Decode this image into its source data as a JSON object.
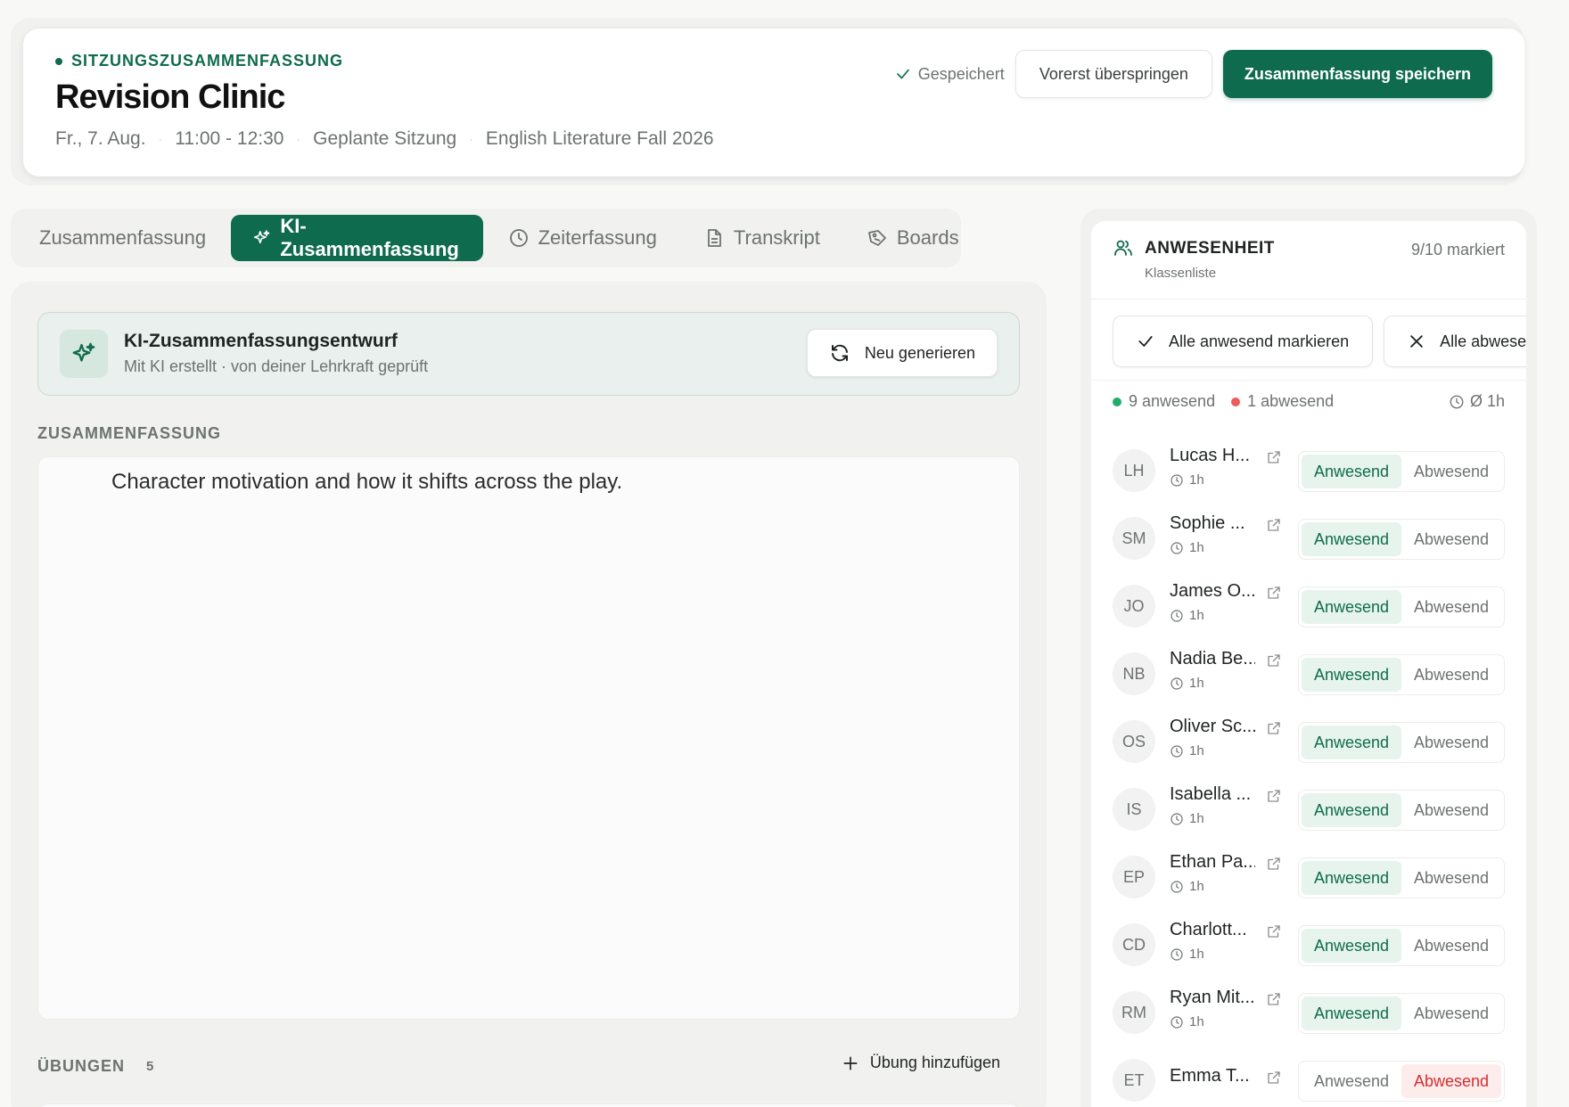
{
  "header": {
    "eyebrow": "SITZUNGSZUSAMMENFASSUNG",
    "title": "Revision Clinic",
    "meta": {
      "date": "Fr., 7. Aug.",
      "time": "11:00 - 12:30",
      "type": "Geplante Sitzung",
      "course": "English Literature Fall 2026"
    },
    "saved_label": "Gespeichert",
    "skip_label": "Vorerst überspringen",
    "save_label": "Zusammenfassung speichern"
  },
  "tabs": [
    {
      "label": "Zusammenfassung",
      "icon": "none",
      "active": false
    },
    {
      "label": "KI-Zusammenfassung",
      "icon": "sparkle-icon",
      "active": true
    },
    {
      "label": "Zeiterfassung",
      "icon": "clock-icon",
      "active": false
    },
    {
      "label": "Transkript",
      "icon": "document-icon",
      "active": false
    },
    {
      "label": "Boards",
      "icon": "board-icon",
      "active": false
    }
  ],
  "draft": {
    "title": "KI-Zusammenfassungsentwurf",
    "subtitle": "Mit KI erstellt · von deiner Lehrkraft geprüft",
    "regenerate_label": "Neu generieren"
  },
  "summary": {
    "section_label": "ZUSAMMENFASSUNG",
    "text": "Character motivation and how it shifts across the play."
  },
  "exercises": {
    "label": "ÜBUNGEN",
    "count": "5",
    "add_label": "Übung hinzufügen"
  },
  "attendance": {
    "title": "ANWESENHEIT",
    "subtitle": "Klassenliste",
    "marked": "9/10 markiert",
    "mark_all_present": "Alle anwesend markieren",
    "mark_all_absent": "Alle abwesend",
    "present_count": "9 anwesend",
    "absent_count": "1 abwesend",
    "average": "Ø 1h",
    "present_label": "Anwesend",
    "absent_label": "Abwesend",
    "students": [
      {
        "initials": "LH",
        "name": "Lucas H...",
        "time": "1h",
        "status": "present"
      },
      {
        "initials": "SM",
        "name": "Sophie ...",
        "time": "1h",
        "status": "present"
      },
      {
        "initials": "JO",
        "name": "James O...",
        "time": "1h",
        "status": "present"
      },
      {
        "initials": "NB",
        "name": "Nadia Be...",
        "time": "1h",
        "status": "present"
      },
      {
        "initials": "OS",
        "name": "Oliver Sc...",
        "time": "1h",
        "status": "present"
      },
      {
        "initials": "IS",
        "name": "Isabella ...",
        "time": "1h",
        "status": "present"
      },
      {
        "initials": "EP",
        "name": "Ethan Pa...",
        "time": "1h",
        "status": "present"
      },
      {
        "initials": "CD",
        "name": "Charlott...",
        "time": "1h",
        "status": "present"
      },
      {
        "initials": "RM",
        "name": "Ryan Mit...",
        "time": "1h",
        "status": "present"
      },
      {
        "initials": "ET",
        "name": "Emma T...",
        "time": "",
        "status": "absent"
      }
    ]
  },
  "colors": {
    "accent": "#0f6b4e",
    "present_dot": "#1fae6a",
    "absent_dot": "#ef5b5b",
    "absent_text": "#d32f2f"
  }
}
